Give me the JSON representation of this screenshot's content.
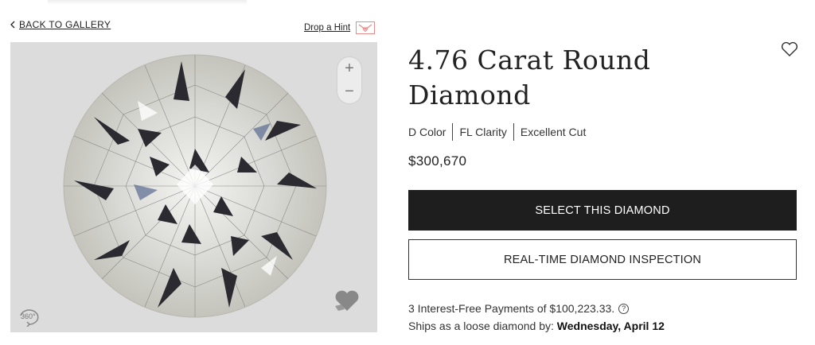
{
  "nav": {
    "back_label": "BACK TO GALLERY",
    "hint_label": "Drop a Hint"
  },
  "viewer": {
    "zoom_in": "+",
    "zoom_out": "−",
    "spin_label": "360°"
  },
  "product": {
    "title": "4.76 Carat Round Diamond",
    "specs": [
      "D Color",
      "FL Clarity",
      "Excellent Cut"
    ],
    "price": "$300,670"
  },
  "actions": {
    "select_label": "SELECT THIS DIAMOND",
    "inspect_label": "REAL-TIME DIAMOND INSPECTION"
  },
  "info": {
    "payments": "3 Interest-Free Payments of $100,223.33.",
    "info_glyph": "?",
    "ships_prefix": "Ships as a loose diamond by:",
    "ships_date": "Wednesday, April 12"
  },
  "colors": {
    "primary_button": "#1e1e1e",
    "hint_accent": "#e88a8a",
    "viewer_bg": "#dcdcdc"
  }
}
